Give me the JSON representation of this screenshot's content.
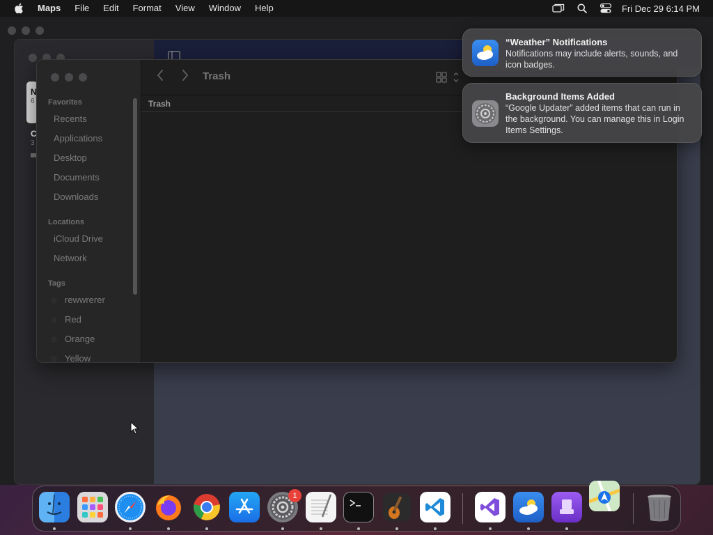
{
  "menubar": {
    "app_name": "Maps",
    "items": [
      "File",
      "Edit",
      "Format",
      "View",
      "Window",
      "Help"
    ],
    "status_icons": [
      "screen-mirroring-icon",
      "spotlight-search-icon",
      "control-center-icon"
    ],
    "clock": "Fri Dec 29  6:14 PM"
  },
  "maps_window": {
    "sidebar_fragments": [
      "N",
      "6",
      "C",
      "3"
    ]
  },
  "finder": {
    "title": "Trash",
    "column_header": "Trash",
    "sidebar": {
      "favorites_title": "Favorites",
      "favorites": [
        "Recents",
        "Applications",
        "Desktop",
        "Documents",
        "Downloads"
      ],
      "locations_title": "Locations",
      "locations": [
        "iCloud Drive",
        "Network"
      ],
      "tags_title": "Tags",
      "tags": [
        "rewwrerer",
        "Red",
        "Orange",
        "Yellow"
      ]
    }
  },
  "notifications": [
    {
      "icon": "weather-icon",
      "title": "“Weather” Notifications",
      "body": "Notifications may include alerts, sounds, and icon badges."
    },
    {
      "icon": "system-settings-icon",
      "title": "Background Items Added",
      "body": "“Google Updater” added items that can run in the background. You can manage this in Login Items Settings."
    }
  ],
  "dock": {
    "apps": [
      "finder-icon",
      "launchpad-icon",
      "safari-icon",
      "firefox-icon",
      "chrome-icon",
      "app-store-icon",
      "system-settings-icon",
      "textedit-icon",
      "terminal-icon",
      "garageband-icon",
      "vscode-icon",
      "visual-studio-icon",
      "weather-icon",
      "apple-configurator-icon",
      "maps-icon",
      "trash-icon"
    ],
    "settings_badge": "1"
  },
  "colors": {
    "badge": "#e8423a",
    "menubar_bg": "#161616",
    "finder_bg": "#1e1e1e"
  }
}
